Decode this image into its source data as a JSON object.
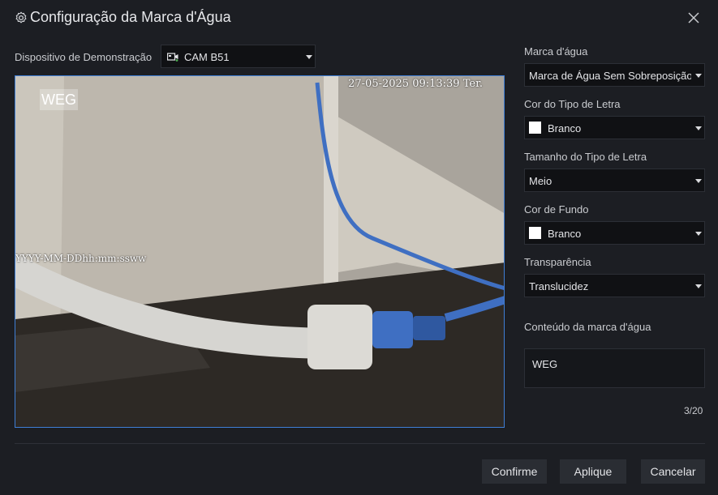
{
  "dialog": {
    "title": "Configuração da Marca d'Água",
    "close_icon": "close-icon",
    "settings_icon": "gear-icon"
  },
  "device": {
    "label": "Dispositivo de Demonstração",
    "value": "CAM B51",
    "icon": "camera-icon"
  },
  "preview": {
    "watermark_text": "WEG",
    "timestamp": "27-05-2025 09:13:39 Ter.",
    "format_overlay": "YYYY-MM-DDhh:mm:ssww"
  },
  "settings": {
    "watermark": {
      "label": "Marca d'água",
      "value": "Marca de Água Sem Sobreposição"
    },
    "font_color": {
      "label": "Cor do Tipo de Letra",
      "value": "Branco",
      "swatch": "#ffffff"
    },
    "font_size": {
      "label": "Tamanho do Tipo de Letra",
      "value": "Meio"
    },
    "background_color": {
      "label": "Cor de Fundo",
      "value": "Branco",
      "swatch": "#ffffff"
    },
    "transparency": {
      "label": "Transparência",
      "value": "Translucidez"
    },
    "content": {
      "label": "Conteúdo da marca d'água",
      "value": "WEG",
      "counter": "3/20"
    }
  },
  "buttons": {
    "confirm": "Confirme",
    "apply": "Aplique",
    "cancel": "Cancelar"
  },
  "colors": {
    "accent_border": "#3f7fd6",
    "background": "#1c1e23"
  }
}
